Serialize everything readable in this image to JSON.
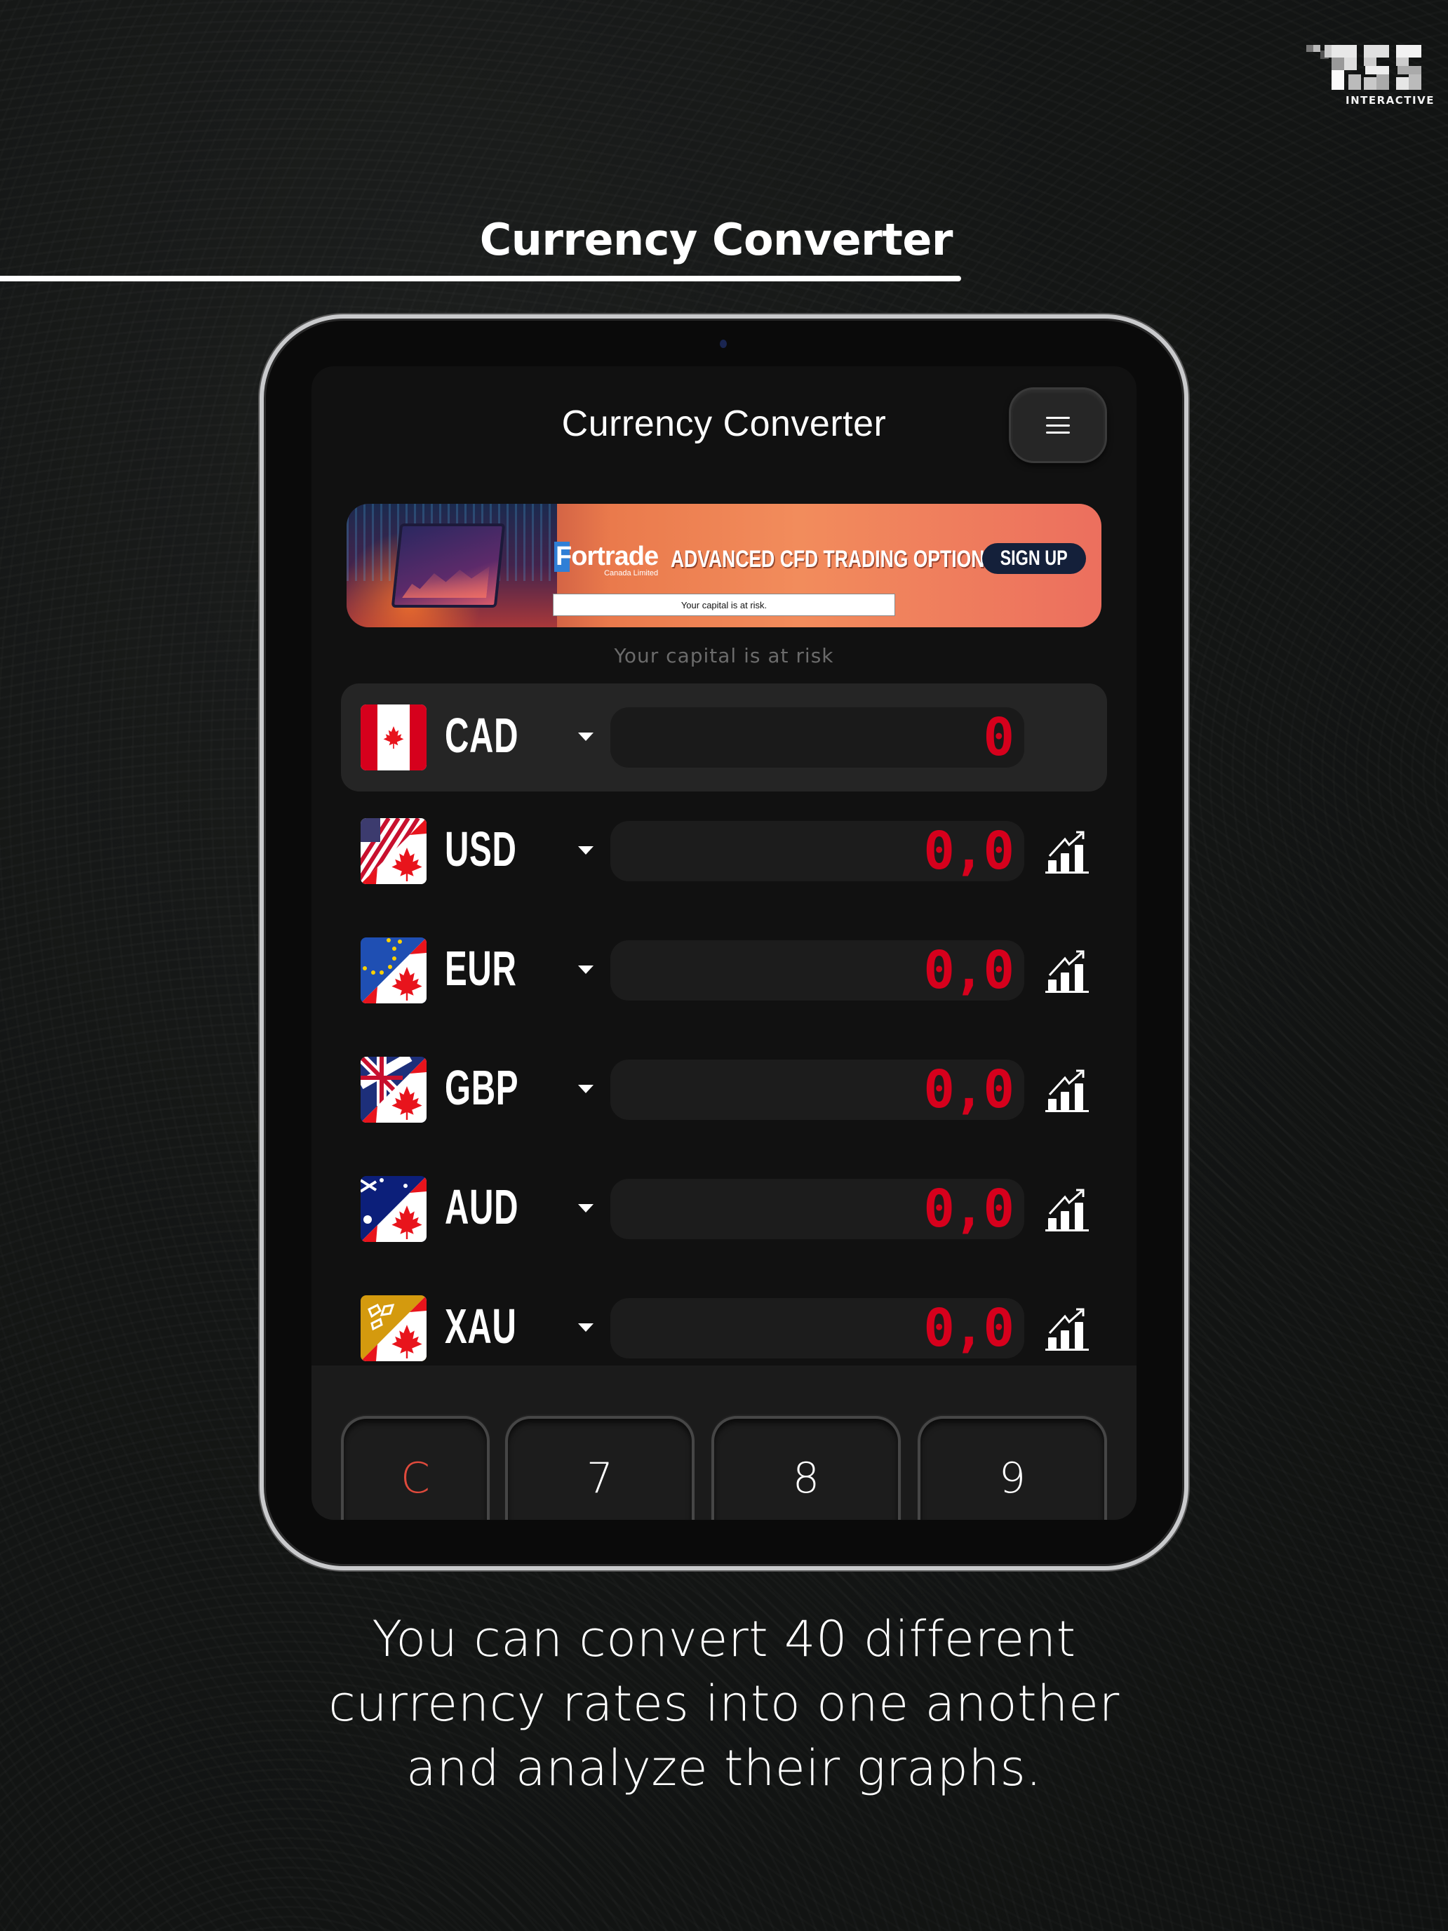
{
  "brand": {
    "logo_text": "RSS",
    "logo_subtitle": "INTERACTIVE"
  },
  "hero": {
    "title": "Currency Converter"
  },
  "app": {
    "title": "Currency Converter",
    "menu_icon": "hamburger-menu-icon"
  },
  "ad": {
    "advertiser": "Fortrade",
    "advertiser_sub": "Canada Limited",
    "headline": "ADVANCED CFD TRADING OPTIONS",
    "cta": "SIGN UP",
    "disclaimer": "Your capital is at risk.",
    "caption": "Your capital is at risk"
  },
  "colors": {
    "accent_red": "#d6001c",
    "clear_key": "#e04a3c",
    "row_selected_bg": "#252525"
  },
  "currencies": [
    {
      "code": "CAD",
      "value": "0",
      "flag": "canada-flag-icon",
      "selected": true,
      "has_chart": false
    },
    {
      "code": "USD",
      "value": "0,0",
      "flag": "usa-canada-flag-icon",
      "selected": false,
      "has_chart": true
    },
    {
      "code": "EUR",
      "value": "0,0",
      "flag": "eu-canada-flag-icon",
      "selected": false,
      "has_chart": true
    },
    {
      "code": "GBP",
      "value": "0,0",
      "flag": "uk-canada-flag-icon",
      "selected": false,
      "has_chart": true
    },
    {
      "code": "AUD",
      "value": "0,0",
      "flag": "australia-canada-flag-icon",
      "selected": false,
      "has_chart": true
    },
    {
      "code": "XAU",
      "value": "0,0",
      "flag": "gold-canada-flag-icon",
      "selected": false,
      "has_chart": true
    }
  ],
  "keypad": {
    "keys": [
      "C",
      "7",
      "8",
      "9"
    ]
  },
  "caption": {
    "lines": [
      "You can convert 40 different",
      "currency rates into one another",
      "and analyze their graphs."
    ]
  }
}
